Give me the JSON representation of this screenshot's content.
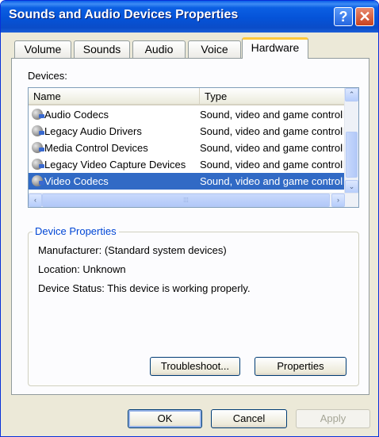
{
  "window": {
    "title": "Sounds and Audio Devices Properties",
    "help_glyph": "?",
    "close_glyph": "✕"
  },
  "tabs": [
    {
      "label": "Volume",
      "active": false
    },
    {
      "label": "Sounds",
      "active": false
    },
    {
      "label": "Audio",
      "active": false
    },
    {
      "label": "Voice",
      "active": false
    },
    {
      "label": "Hardware",
      "active": true
    }
  ],
  "devices": {
    "label": "Devices:",
    "columns": [
      "Name",
      "Type"
    ],
    "rows": [
      {
        "name": "Audio Codecs",
        "type": "Sound, video and game controllers",
        "icon": "speaker-device-icon"
      },
      {
        "name": "Legacy Audio Drivers",
        "type": "Sound, video and game controllers",
        "icon": "speaker-device-icon"
      },
      {
        "name": "Media Control Devices",
        "type": "Sound, video and game controllers",
        "icon": "speaker-device-icon"
      },
      {
        "name": "Legacy Video Capture Devices",
        "type": "Sound, video and game controllers",
        "icon": "speaker-device-icon"
      },
      {
        "name": "Video Codecs",
        "type": "Sound, video and game controllers",
        "icon": "speaker-device-icon"
      }
    ],
    "selected_index": 4,
    "scroll_up": "⌃",
    "scroll_down": "⌄",
    "scroll_left": "‹",
    "scroll_right": "›",
    "grip": "⁞⁞⁞"
  },
  "device_properties": {
    "title": "Device Properties",
    "manufacturer": "Manufacturer: (Standard system devices)",
    "location": "Location: Unknown",
    "status": "Device Status: This device is working properly.",
    "troubleshoot_label": "Troubleshoot...",
    "properties_label": "Properties"
  },
  "footer": {
    "ok_label": "OK",
    "cancel_label": "Cancel",
    "apply_label": "Apply"
  },
  "colors": {
    "selection": "#316ac5",
    "title_bar": "#0553d8",
    "group_title": "#0046d5"
  }
}
